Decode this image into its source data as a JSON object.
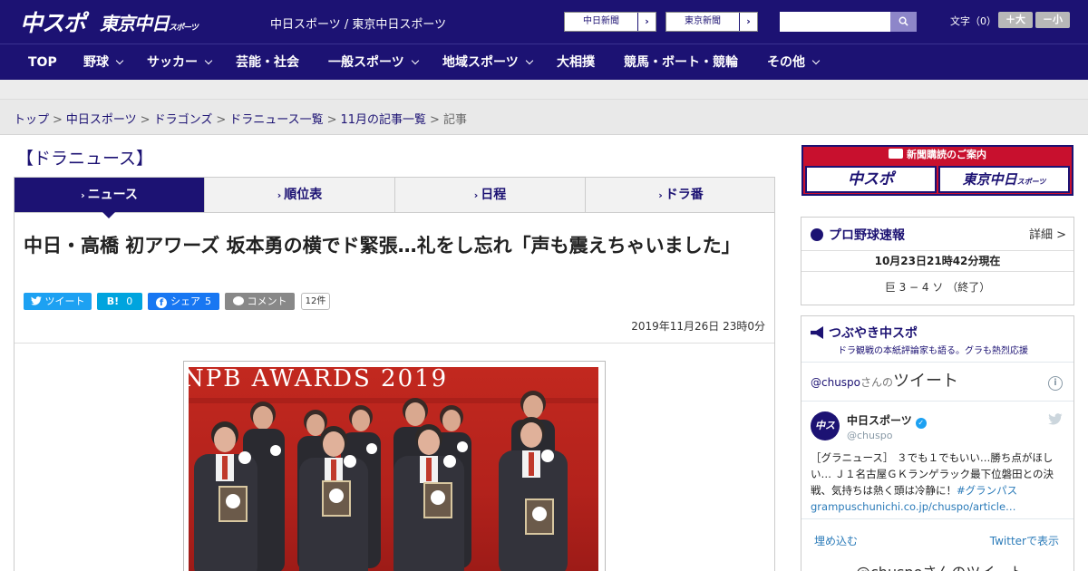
{
  "header": {
    "logo_chuspo": "中スポ",
    "logo_tokyo": "東京中日",
    "logo_tokyo_sub": "スポーツ",
    "site_names": "中日スポーツ / 東京中日スポーツ",
    "paper_links": [
      "中日新聞",
      "東京新聞"
    ],
    "search_placeholder": "",
    "font_size_label": "文字（0）",
    "font_plus": "＋大",
    "font_minus": "－小"
  },
  "nav": {
    "items": [
      {
        "label": "TOP",
        "dropdown": false
      },
      {
        "label": "野球",
        "dropdown": true
      },
      {
        "label": "サッカー",
        "dropdown": true
      },
      {
        "label": "芸能・社会",
        "dropdown": false
      },
      {
        "label": "一般スポーツ",
        "dropdown": true
      },
      {
        "label": "地域スポーツ",
        "dropdown": true
      },
      {
        "label": "大相撲",
        "dropdown": false
      },
      {
        "label": "競馬・ボート・競輪",
        "dropdown": false
      },
      {
        "label": "その他",
        "dropdown": true
      }
    ]
  },
  "breadcrumb": [
    "トップ",
    "中日スポーツ",
    "ドラゴンズ",
    "ドラニュース一覧",
    "11月の記事一覧",
    "記事"
  ],
  "section_title": "【ドラニュース】",
  "tabs": [
    "ニュース",
    "順位表",
    "日程",
    "ドラ番"
  ],
  "article": {
    "headline": "中日・高橋 初アワーズ 坂本勇の横でド緊張…礼をし忘れ「声も震えちゃいました」",
    "share": {
      "tweet": "ツイート",
      "hatena_label": "B!",
      "hatena_count": "0",
      "facebook_label": "シェア",
      "facebook_count": "5",
      "comment_label": "コメント",
      "comment_count": "12件"
    },
    "date": "2019年11月26日 23時0分",
    "photo_caption_text": "NPB AWARDS 2019"
  },
  "sidebar": {
    "ad_title": "新聞購読のご案内",
    "ad_buttons": [
      "中スポ",
      "東京中日"
    ],
    "ad_sub": "スポーツ",
    "baseball": {
      "title": "プロ野球速報",
      "detail": "詳細 >",
      "timestamp": "10月23日21時42分現在",
      "score": "巨 3 − 4 ソ （終了）"
    },
    "tsubuyaki": {
      "title": "つぶやき中スポ",
      "subtitle": "ドラ観戦の本紙評論家も語る。グラも熱烈応援"
    },
    "twitter": {
      "handle_prefix": "@chuspo",
      "handle_suffix": "さんの",
      "heading": "ツイート",
      "account_name": "中日スポーツ",
      "account_handle": "@chuspo",
      "tweet_text": "［グラニュース］ ３でも１でもいい…勝ち点がほしい… Ｊ１名古屋ＧＫランゲラック最下位磐田との決戦、気持ちは熱く頭は冷静に！",
      "hashtag": "#グランパス",
      "link": "grampuschunichi.co.jp/chuspo/article…",
      "embed": "埋め込む",
      "view_on_twitter": "Twitterで表示",
      "bottom_heading": "@chuspoさんのツイート"
    }
  },
  "colors": {
    "brand_navy": "#1c1273",
    "accent_red": "#c8102e",
    "twitter_blue": "#1da1f2",
    "hatena_blue": "#00a4de",
    "facebook_blue": "#1877f2"
  }
}
